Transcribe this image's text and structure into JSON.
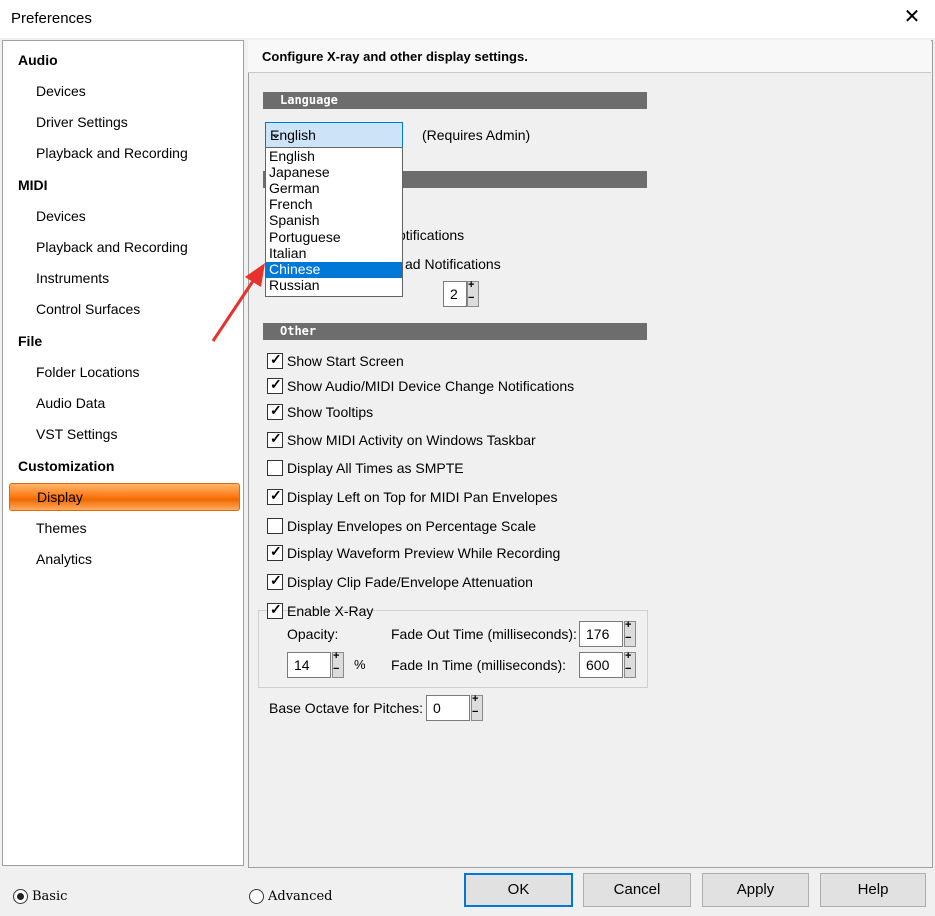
{
  "window": {
    "title": "Preferences",
    "close_glyph": "✕"
  },
  "sidebar": {
    "categories": [
      {
        "label": "Audio",
        "items": [
          "Devices",
          "Driver Settings",
          "Playback and Recording"
        ]
      },
      {
        "label": "MIDI",
        "items": [
          "Devices",
          "Playback and Recording",
          "Instruments",
          "Control Surfaces"
        ]
      },
      {
        "label": "File",
        "items": [
          "Folder Locations",
          "Audio Data",
          "VST Settings"
        ]
      },
      {
        "label": "Customization",
        "items": [
          "Display",
          "Themes",
          "Analytics"
        ]
      }
    ],
    "selected": "Display"
  },
  "main": {
    "header": "Configure X-ray and other display settings.",
    "language": {
      "section": "Language",
      "selected": "English",
      "note": "(Requires Admin)",
      "options": [
        "English",
        "Japanese",
        "German",
        "French",
        "Spanish",
        "Portuguese",
        "Italian",
        "Chinese",
        "Russian"
      ],
      "highlighted": "Chinese"
    },
    "hidden_fragments": {
      "line1": "otifications",
      "line2": "ad Notifications",
      "timeout_value": "2"
    },
    "other": {
      "section": "Other",
      "checkboxes": [
        {
          "label": "Show Start Screen",
          "checked": true
        },
        {
          "label": "Show Audio/MIDI Device Change Notifications",
          "checked": true
        },
        {
          "label": "Show Tooltips",
          "checked": true
        },
        {
          "label": "Show MIDI Activity on Windows Taskbar",
          "checked": true
        },
        {
          "label": "Display All Times as SMPTE",
          "checked": false
        },
        {
          "label": "Display Left on Top for MIDI Pan Envelopes",
          "checked": true
        },
        {
          "label": "Display Envelopes on Percentage Scale",
          "checked": false
        },
        {
          "label": "Display Waveform Preview While Recording",
          "checked": true
        },
        {
          "label": "Display Clip Fade/Envelope Attenuation",
          "checked": true
        }
      ]
    },
    "xray": {
      "enable_label": "Enable X-Ray",
      "enabled": true,
      "opacity_label": "Opacity:",
      "opacity_value": "14",
      "opacity_unit": "%",
      "fade_out_label": "Fade Out Time (milliseconds):",
      "fade_out_value": "176",
      "fade_in_label": "Fade In Time (milliseconds):",
      "fade_in_value": "600"
    },
    "base_octave": {
      "label": "Base Octave for Pitches:",
      "value": "0"
    }
  },
  "footer": {
    "mode_basic": "Basic",
    "mode_advanced": "Advanced",
    "selected_mode": "Basic",
    "buttons": {
      "ok": "OK",
      "cancel": "Cancel",
      "apply": "Apply",
      "help": "Help"
    }
  },
  "colors": {
    "accent": "#0078d7",
    "selection_orange": "#ff7c1a",
    "section_bar": "#6d6d6d",
    "annotation_arrow": "#e8312a"
  }
}
